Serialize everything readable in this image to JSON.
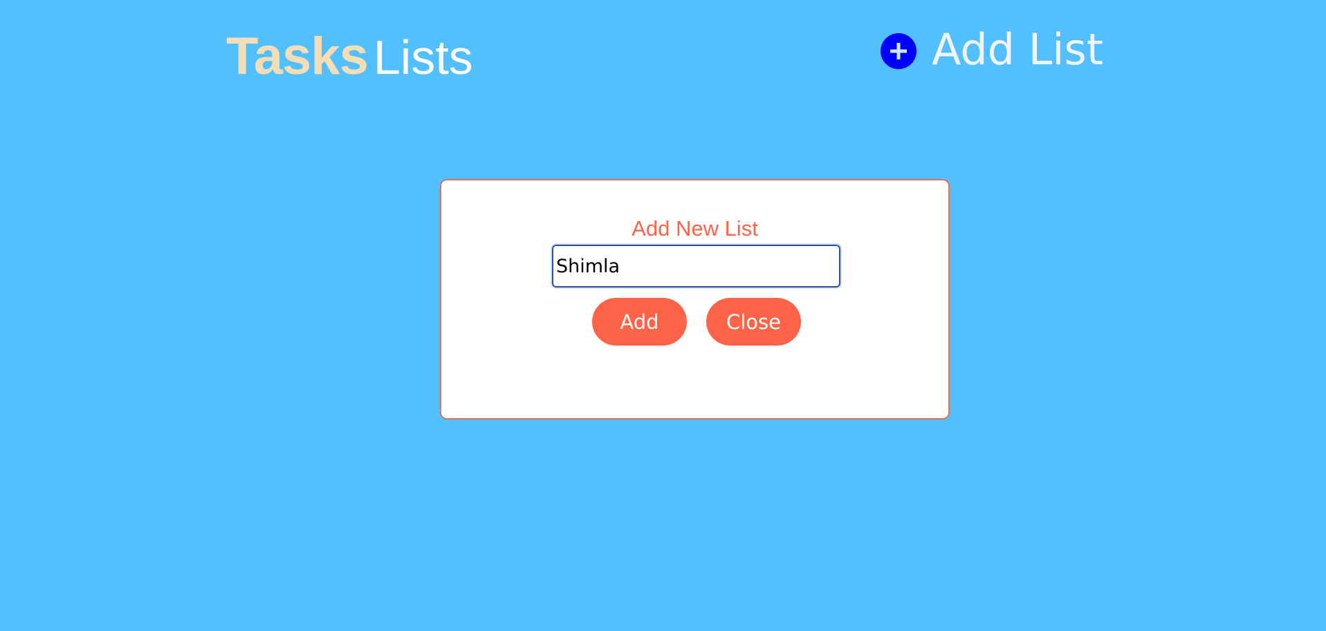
{
  "header": {
    "brand_bold": "Tasks",
    "brand_light": "Lists",
    "add_list_label": "Add List",
    "add_list_icon": "plus-circle-icon"
  },
  "modal": {
    "title": "Add New List",
    "input_value": "Shimla",
    "add_label": "Add",
    "close_label": "Close"
  },
  "colors": {
    "background": "#52bffe",
    "brand_bold": "#f5deb3",
    "accent": "#ff6347",
    "icon_circle": "#0000ff"
  }
}
